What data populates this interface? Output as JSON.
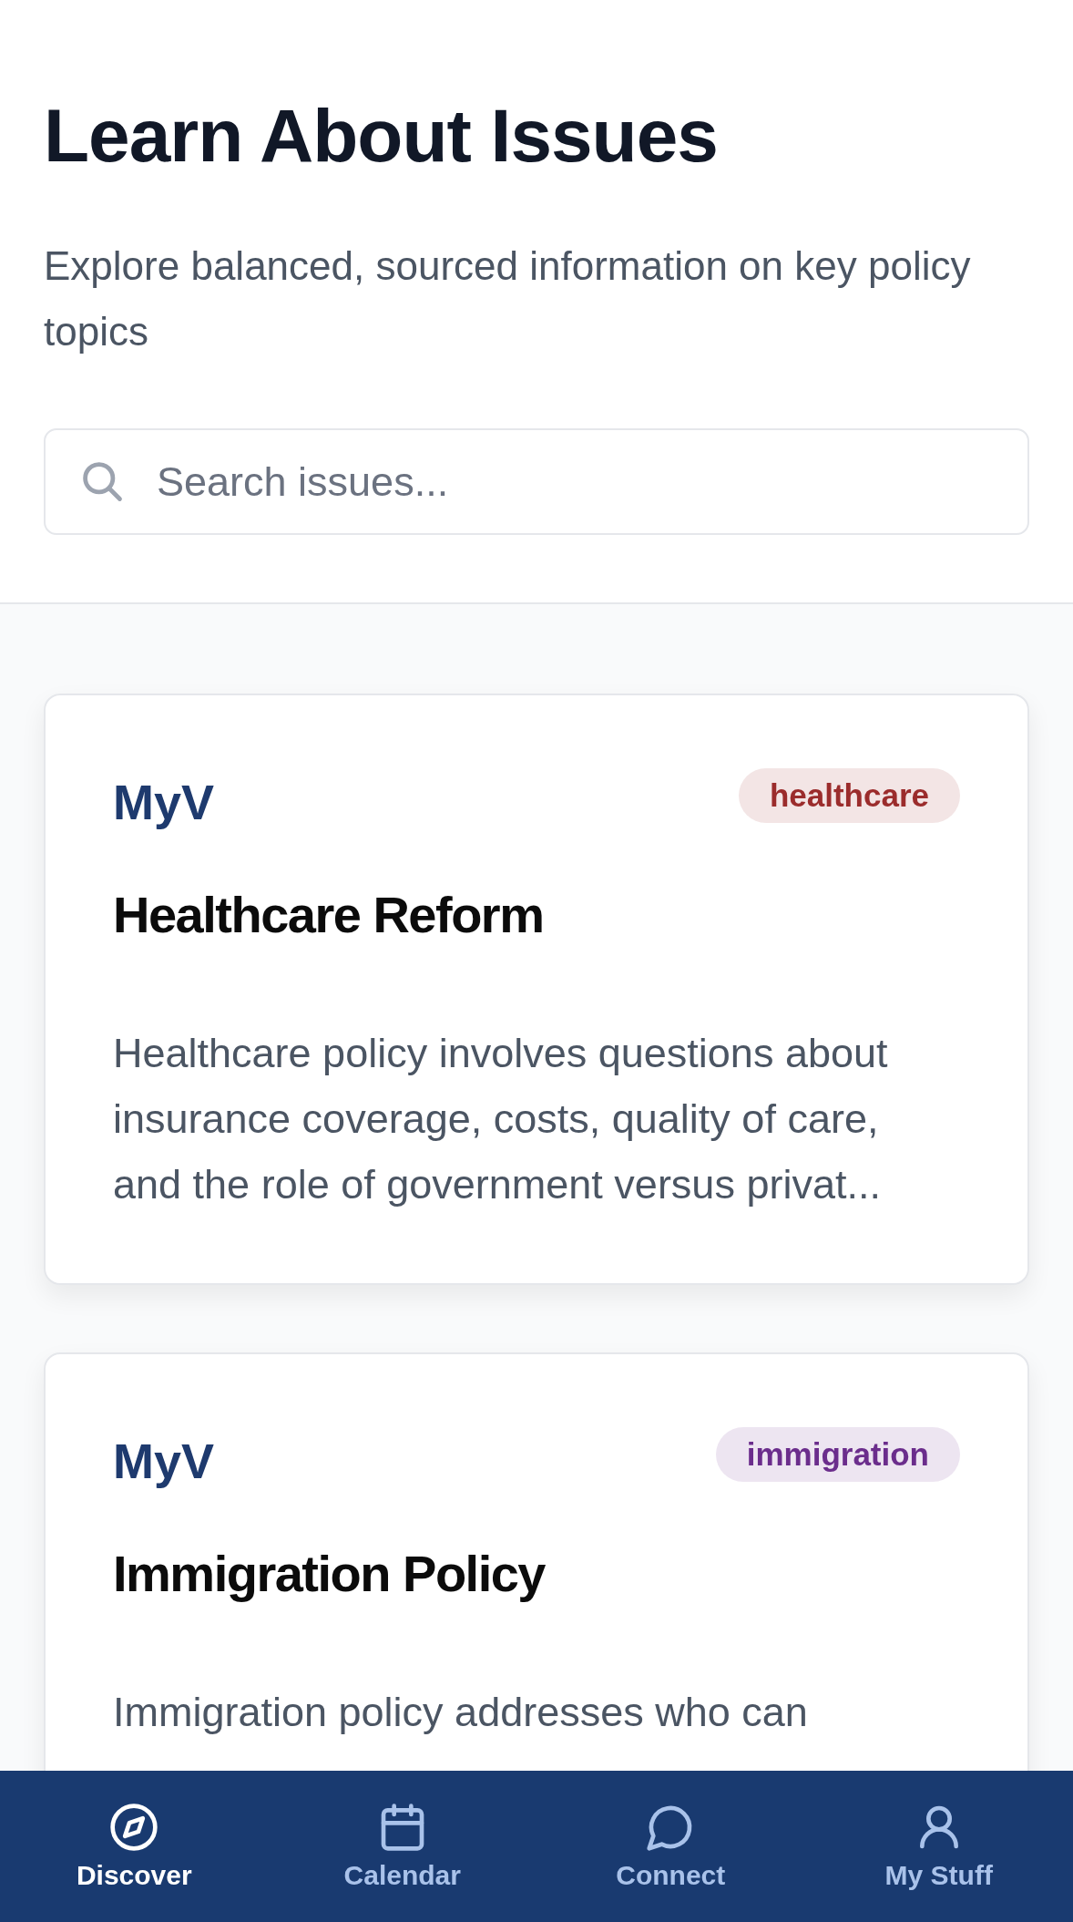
{
  "header": {
    "title": "Learn About Issues",
    "subtitle": "Explore balanced, sourced information on key policy topics"
  },
  "search": {
    "placeholder": "Search issues..."
  },
  "issues": [
    {
      "source": "MyV",
      "tag": "healthcare",
      "color": "#9b2c2c",
      "title": "Healthcare Reform",
      "summary": "Healthcare policy involves questions about insurance coverage, costs, quality of care, and the role of government versus privat..."
    },
    {
      "source": "MyV",
      "tag": "immigration",
      "color": "#6b2d8c",
      "title": "Immigration Policy",
      "summary": "Immigration policy addresses who can"
    }
  ],
  "nav": [
    {
      "label": "Discover",
      "kind": "compass",
      "selected": true
    },
    {
      "label": "Calendar",
      "kind": "calendar",
      "selected": false
    },
    {
      "label": "Connect",
      "kind": "chat",
      "selected": false
    },
    {
      "label": "My Stuff",
      "kind": "person",
      "selected": false
    }
  ]
}
